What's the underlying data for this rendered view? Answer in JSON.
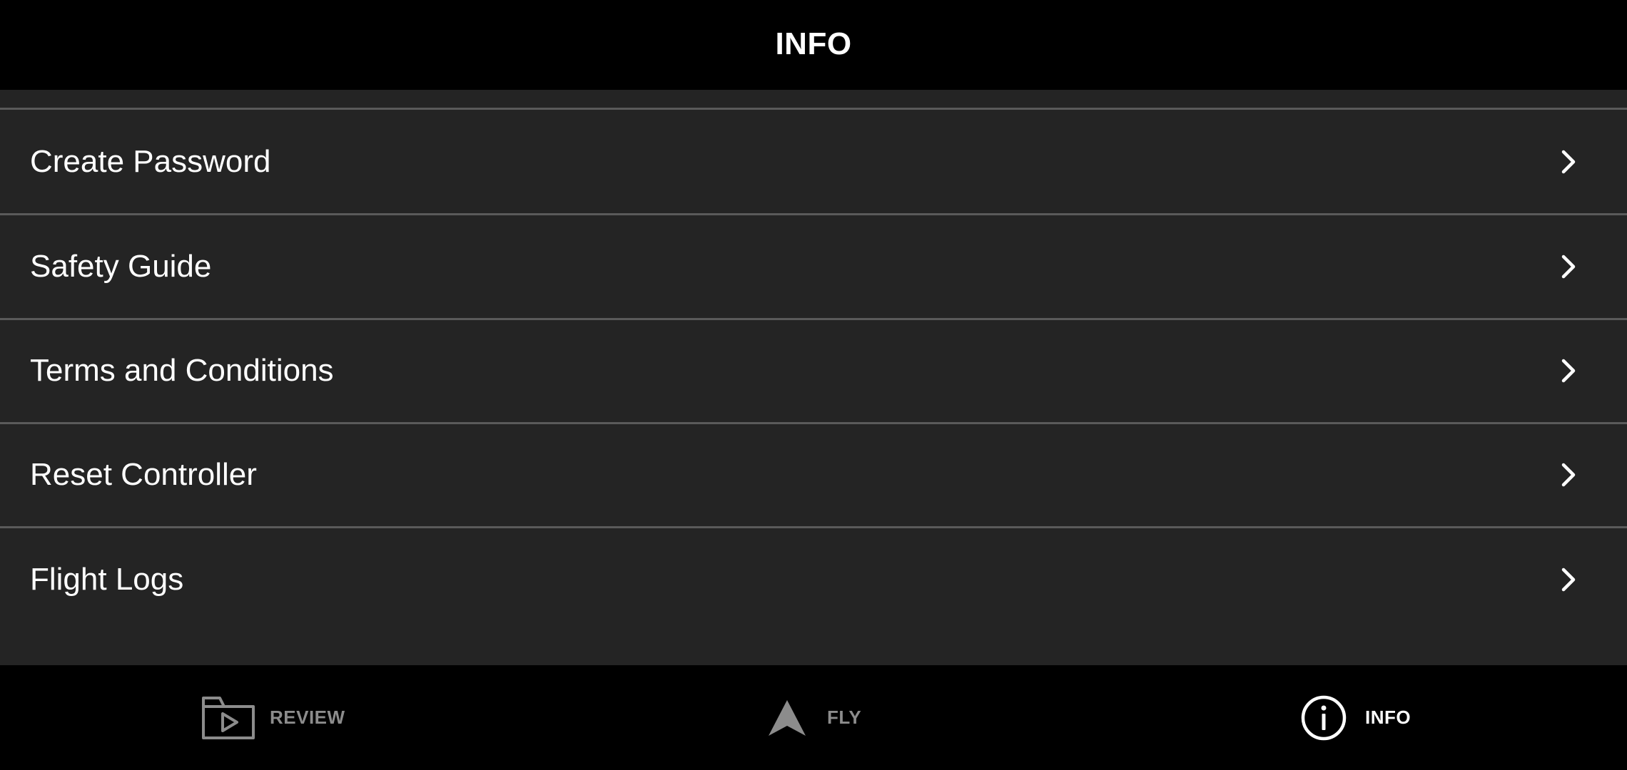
{
  "header": {
    "title": "INFO"
  },
  "menu": {
    "items": [
      {
        "label": "Create Password",
        "icon": "chevron-right-icon"
      },
      {
        "label": "Safety Guide",
        "icon": "chevron-right-icon"
      },
      {
        "label": "Terms and Conditions",
        "icon": "chevron-right-icon"
      },
      {
        "label": "Reset Controller",
        "icon": "chevron-right-icon"
      },
      {
        "label": "Flight Logs",
        "icon": "chevron-right-icon"
      }
    ]
  },
  "tabbar": {
    "tabs": [
      {
        "label": "REVIEW",
        "icon": "folder-play-icon",
        "active": false
      },
      {
        "label": "FLY",
        "icon": "arrow-navigation-icon",
        "active": false
      },
      {
        "label": "INFO",
        "icon": "info-circle-icon",
        "active": true
      }
    ]
  },
  "colors": {
    "background": "#000000",
    "list_background": "#242424",
    "divider": "#5a5a5a",
    "text_primary": "#ffffff",
    "text_inactive": "#8c8c8c"
  }
}
